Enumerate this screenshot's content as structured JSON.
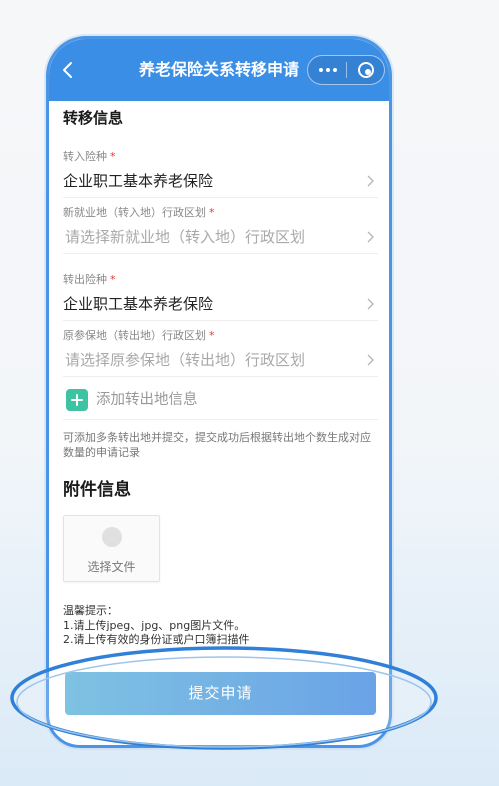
{
  "window": {
    "title": "养老保险关系转移申请"
  },
  "icons": {
    "back": "chevron-left-icon",
    "more": "more-dots-icon",
    "close": "target-circle-icon",
    "field_arrow": "chevron-right-icon",
    "add": "plus-icon",
    "upload": "upload-circle-icon"
  },
  "colors": {
    "header": "#3a8ee6",
    "frame": "#4a95e5",
    "accent_green": "#3dc3a2",
    "required": "#e53935",
    "button_start": "#63b5dc",
    "button_end": "#4a8fe2",
    "highlight": "#2f80d6"
  },
  "transfer": {
    "section_title": "转移信息",
    "fields": [
      {
        "label": "转入险种",
        "required_mark": "*",
        "value": "企业职工基本养老保险"
      },
      {
        "label": "新就业地（转入地）行政区划",
        "required_mark": "*",
        "placeholder": "请选择新就业地（转入地）行政区划"
      },
      {
        "label": "转出险种",
        "required_mark": "*",
        "value": "企业职工基本养老保险"
      },
      {
        "label": "原参保地（转出地）行政区划",
        "required_mark": "*",
        "placeholder": "请选择原参保地（转出地）行政区划"
      }
    ],
    "add_label": "添加转出地信息",
    "note": "可添加多条转出地并提交，提交成功后根据转出地个数生成对应数量的申请记录"
  },
  "attachments": {
    "section_title": "附件信息",
    "upload_label": "选择文件",
    "tips_title": "温馨提示：",
    "tips": [
      "1.请上传jpeg、jpg、png图片文件。",
      "2.请上传有效的身份证或户口簿扫描件"
    ]
  },
  "submit": {
    "label": "提交申请"
  }
}
